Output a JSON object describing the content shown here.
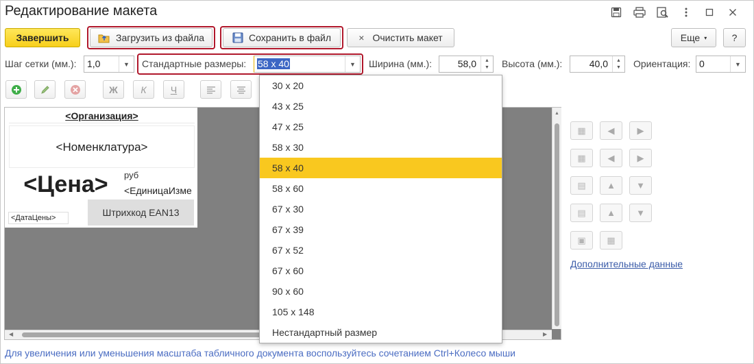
{
  "window": {
    "title": "Редактирование макета",
    "icons": [
      "save-icon",
      "print-icon",
      "preview-icon",
      "more-icon",
      "minimize-icon",
      "close-icon"
    ]
  },
  "toolbar": {
    "finish_label": "Завершить",
    "load_label": "Загрузить из файла",
    "save_label": "Сохранить в файл",
    "clear_label": "Очистить макет",
    "more_label": "Еще",
    "help_label": "?"
  },
  "fields": {
    "grid_step_label": "Шаг сетки (мм.):",
    "grid_step_value": "1,0",
    "std_sizes_label": "Стандартные размеры:",
    "std_sizes_value": "58 x 40",
    "width_label": "Ширина (мм.):",
    "width_value": "58,0",
    "height_label": "Высота (мм.):",
    "height_value": "40,0",
    "orientation_label": "Ориентация:",
    "orientation_value": "0"
  },
  "format_icons": [
    "add-icon",
    "edit-icon",
    "delete-icon",
    "bold-icon",
    "italic-icon",
    "underline-icon",
    "align-left-icon",
    "align-center-icon"
  ],
  "format_labels": {
    "bold": "Ж",
    "italic": "К",
    "underline": "Ч"
  },
  "label": {
    "organization": "<Организация>",
    "nomenclature": "<Номенклатура>",
    "price": "<Цена>",
    "currency": "руб",
    "unit": "<ЕдиницаИзме",
    "price_date": "<ДатаЦены>",
    "barcode": "Штрихкод EAN13"
  },
  "dropdown": {
    "items": [
      "30 x 20",
      "43 x 25",
      "47 x 25",
      "58 x 30",
      "58 x 40",
      "58 x 60",
      "67 x 30",
      "67 x 39",
      "67 x 52",
      "67 x 60",
      "90 x 60",
      "105 x 148",
      "Нестандартный размер"
    ],
    "selected": "58 x 40"
  },
  "side_panel": {
    "link": "Дополнительные данные"
  },
  "hint": "Для увеличения или уменьшения масштаба табличного документа воспользуйтесь сочетанием Ctrl+Колесо мыши"
}
